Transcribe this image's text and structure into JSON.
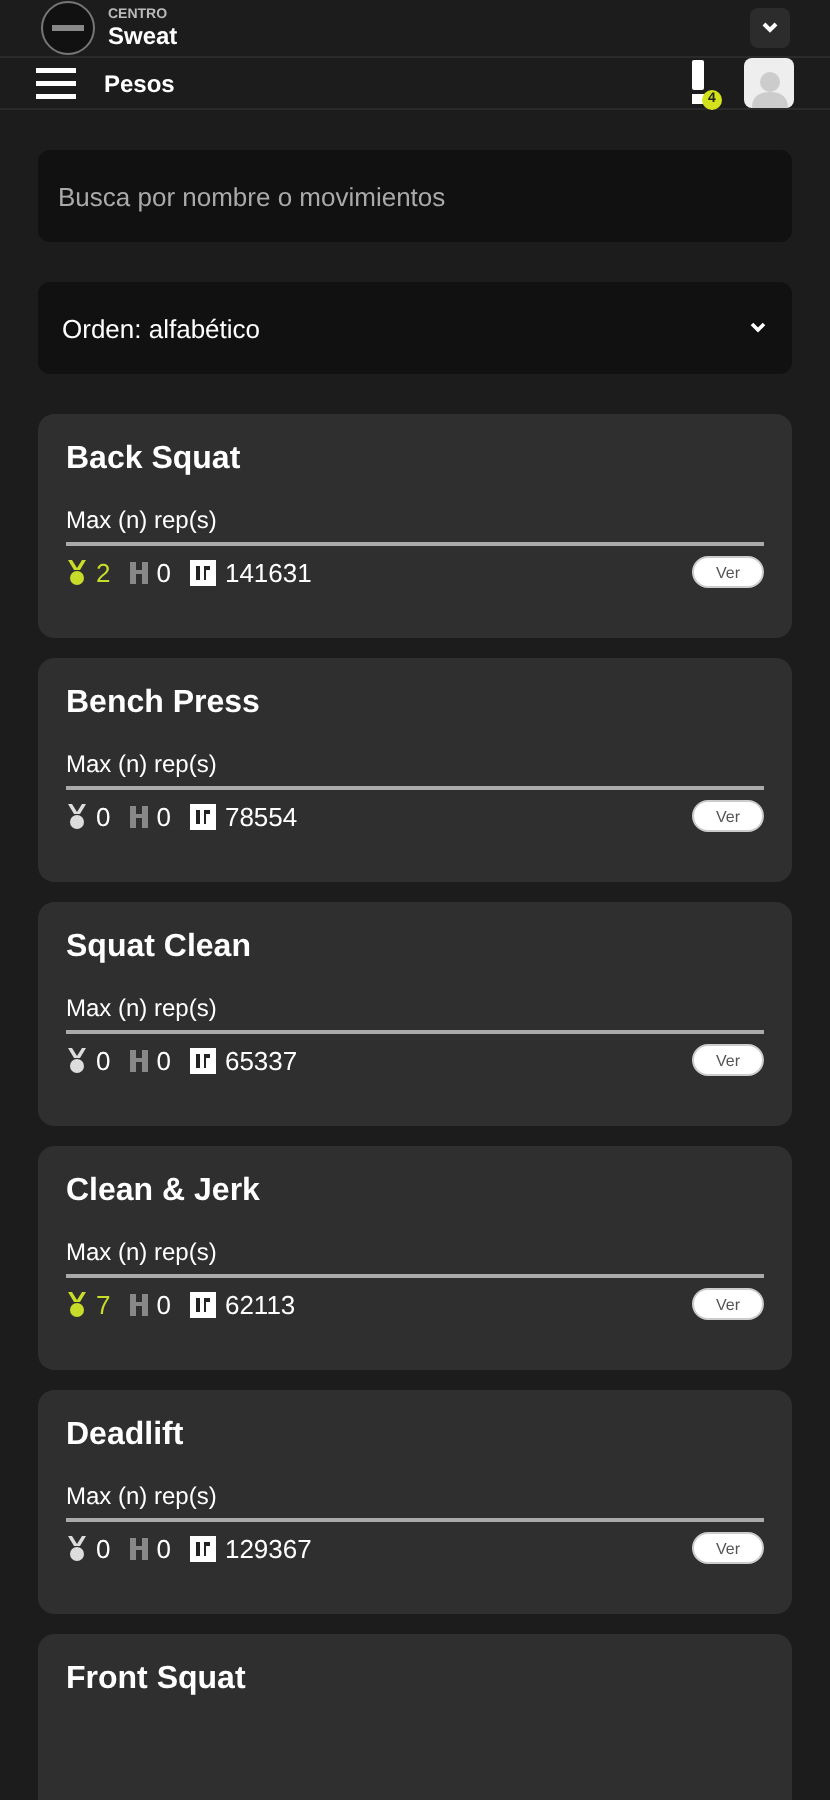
{
  "header": {
    "subtitle": "CENTRO",
    "title": "Sweat"
  },
  "nav": {
    "title": "Pesos",
    "alert_count": "4"
  },
  "search": {
    "placeholder": "Busca por nombre o movimientos"
  },
  "sort": {
    "value": "Orden: alfabético"
  },
  "cards": [
    {
      "name": "Back Squat",
      "metric": "Max (n) rep(s)",
      "medals": "2",
      "medals_highlighted": true,
      "records": "0",
      "id": "141631",
      "button": "Ver"
    },
    {
      "name": "Bench Press",
      "metric": "Max (n) rep(s)",
      "medals": "0",
      "medals_highlighted": false,
      "records": "0",
      "id": "78554",
      "button": "Ver"
    },
    {
      "name": "Squat Clean",
      "metric": "Max (n) rep(s)",
      "medals": "0",
      "medals_highlighted": false,
      "records": "0",
      "id": "65337",
      "button": "Ver"
    },
    {
      "name": "Clean & Jerk",
      "metric": "Max (n) rep(s)",
      "medals": "7",
      "medals_highlighted": true,
      "records": "0",
      "id": "62113",
      "button": "Ver"
    },
    {
      "name": "Deadlift",
      "metric": "Max (n) rep(s)",
      "medals": "0",
      "medals_highlighted": false,
      "records": "0",
      "id": "129367",
      "button": "Ver"
    },
    {
      "name": "Front Squat"
    }
  ]
}
